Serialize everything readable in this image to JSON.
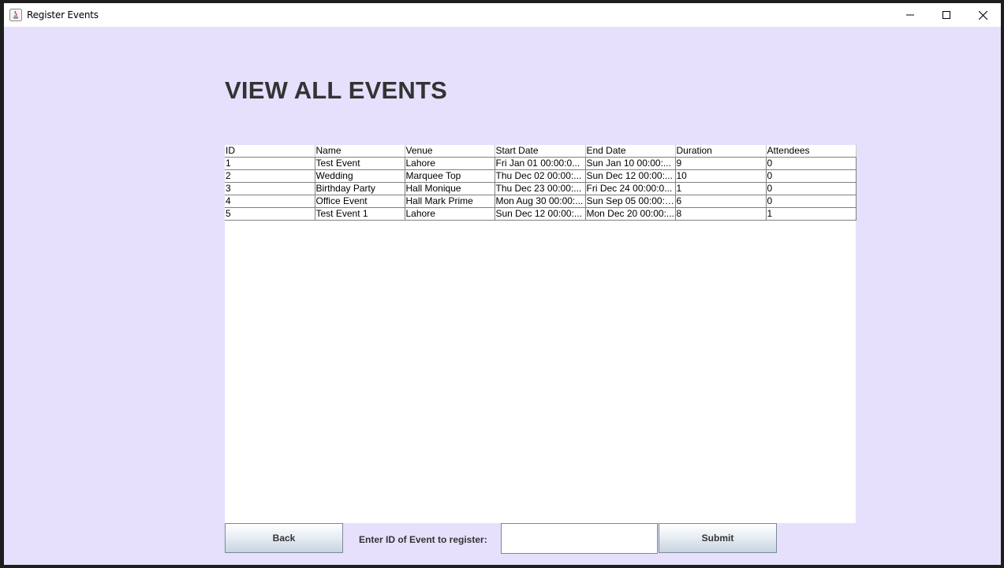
{
  "window": {
    "title": "Register Events",
    "bg_color": "#e6e0fc"
  },
  "page": {
    "heading": "VIEW ALL EVENTS"
  },
  "table": {
    "columns": [
      "ID",
      "Name",
      "Venue",
      "Start Date",
      "End Date",
      "Duration",
      "Attendees"
    ],
    "rows": [
      [
        "1",
        "Test Event",
        "Lahore",
        "Fri Jan 01 00:00:0...",
        "Sun Jan 10 00:00:...",
        "9",
        "0"
      ],
      [
        "2",
        "Wedding",
        "Marquee Top",
        "Thu Dec 02 00:00:...",
        "Sun Dec 12 00:00:...",
        "10",
        "0"
      ],
      [
        "3",
        "Birthday Party",
        "Hall Monique",
        "Thu Dec 23 00:00:...",
        "Fri Dec 24 00:00:0...",
        "1",
        "0"
      ],
      [
        "4",
        "Office Event",
        "Hall Mark Prime",
        "Mon Aug 30 00:00:...",
        "Sun Sep 05 00:00:0...",
        "6",
        "0"
      ],
      [
        "5",
        "Test Event 1",
        "Lahore",
        "Sun Dec 12 00:00:...",
        "Mon Dec 20 00:00:...",
        "8",
        "1"
      ]
    ]
  },
  "footer": {
    "back_label": "Back",
    "prompt_label": "Enter ID of Event to register:",
    "id_value": "",
    "submit_label": "Submit"
  },
  "icons": {
    "app": "java-app-icon",
    "minimize": "minimize-icon",
    "maximize": "maximize-icon",
    "close": "close-icon"
  }
}
